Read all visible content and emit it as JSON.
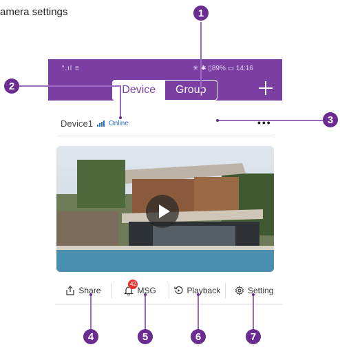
{
  "page_title": "amera settings",
  "status_bar": {
    "left": "“.ıl ≡",
    "right": "✳ ✱ ▯89% ▭ 14:16"
  },
  "tabs": [
    {
      "label": "Device",
      "active": true
    },
    {
      "label": "Group",
      "active": false
    }
  ],
  "device": {
    "name": "Device1",
    "status": "Online"
  },
  "actions": [
    {
      "label": "Share",
      "icon": "share-icon"
    },
    {
      "label": "MSG",
      "icon": "bell-icon",
      "badge": "42"
    },
    {
      "label": "Playback",
      "icon": "playback-icon"
    },
    {
      "label": "Setting",
      "icon": "gear-icon"
    }
  ],
  "callouts": [
    "1",
    "2",
    "3",
    "4",
    "5",
    "6",
    "7"
  ],
  "colors": {
    "brand": "#7b3fa3",
    "callout": "#6a2c91",
    "online": "#2f6fc8",
    "badge": "#e53935"
  }
}
